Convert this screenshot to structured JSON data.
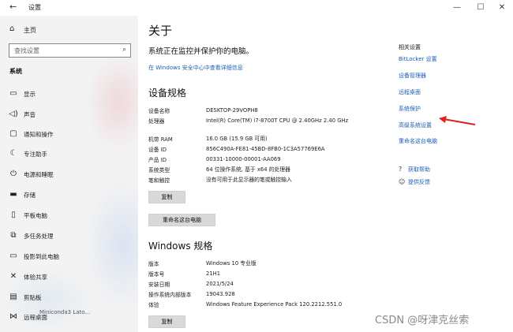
{
  "window": {
    "back_icon": "back-arrow-icon",
    "title": "设置",
    "minimize_glyph": "—",
    "maximize_glyph": "☐",
    "close_glyph": "✕"
  },
  "sidebar": {
    "home_label": "主页",
    "search_placeholder": "查找设置",
    "section_label": "系统",
    "items": [
      {
        "label": "显示",
        "icon": "monitor-icon"
      },
      {
        "label": "声音",
        "icon": "speaker-icon"
      },
      {
        "label": "通知和操作",
        "icon": "notification-icon"
      },
      {
        "label": "专注助手",
        "icon": "moon-icon"
      },
      {
        "label": "电源和睡眠",
        "icon": "power-icon"
      },
      {
        "label": "存储",
        "icon": "storage-icon"
      },
      {
        "label": "平板电脑",
        "icon": "tablet-icon"
      },
      {
        "label": "多任务处理",
        "icon": "multitask-icon"
      },
      {
        "label": "投影到此电脑",
        "icon": "projector-icon"
      },
      {
        "label": "体验共享",
        "icon": "share-icon"
      },
      {
        "label": "剪贴板",
        "icon": "clipboard-icon"
      },
      {
        "label": "远程桌面",
        "icon": "remote-desktop-icon"
      }
    ],
    "bottom_partial_text": "Miniconda3 Lato..."
  },
  "main": {
    "title": "关于",
    "protect_text": "系统正在监控并保护你的电脑。",
    "protect_link": "在 Windows 安全中心中查看详细信息",
    "device_spec_title": "设备规格",
    "device_specs": [
      {
        "key": "设备名称",
        "value": "DESKTOP-29VOPH8"
      },
      {
        "key": "处理器",
        "value": "Intel(R) Core(TM) i7-8700T CPU @ 2.40GHz 2.40 GHz"
      },
      {
        "key": "机带 RAM",
        "value": "16.0 GB (15.9 GB 可用)"
      },
      {
        "key": "设备 ID",
        "value": "856C490A-FE81-45BD-8FB0-1C3A57769E6A"
      },
      {
        "key": "产品 ID",
        "value": "00331-10000-00001-AA069"
      },
      {
        "key": "系统类型",
        "value": "64 位操作系统, 基于 x64 的处理器"
      },
      {
        "key": "笔和触控",
        "value": "没有可用于此显示器的笔或触控输入"
      }
    ],
    "copy_label": "复制",
    "rename_label": "重命名这台电脑",
    "windows_spec_title": "Windows 规格",
    "windows_specs": [
      {
        "key": "版本",
        "value": "Windows 10 专业版"
      },
      {
        "key": "版本号",
        "value": "21H1"
      },
      {
        "key": "安装日期",
        "value": "2021/5/24"
      },
      {
        "key": "操作系统内部版本",
        "value": "19043.928"
      },
      {
        "key": "体验",
        "value": "Windows Feature Experience Pack 120.2212.551.0"
      }
    ],
    "copy2_label": "复制"
  },
  "related": {
    "heading": "相关设置",
    "links": [
      "BitLocker 设置",
      "设备管理器",
      "远程桌面",
      "系统保护",
      "高级系统设置",
      "重命名这台电脑"
    ],
    "help": [
      {
        "label": "获取帮助",
        "icon": "help-icon"
      },
      {
        "label": "提供反馈",
        "icon": "feedback-icon"
      }
    ]
  },
  "annotation": {
    "arrow_color": "#e02020"
  },
  "watermark": "CSDN @呀津克丝索",
  "colors": {
    "link": "#1a5fb4",
    "sidebar_bg": "#f3f3f3",
    "button_bg": "#d9d9d9"
  }
}
